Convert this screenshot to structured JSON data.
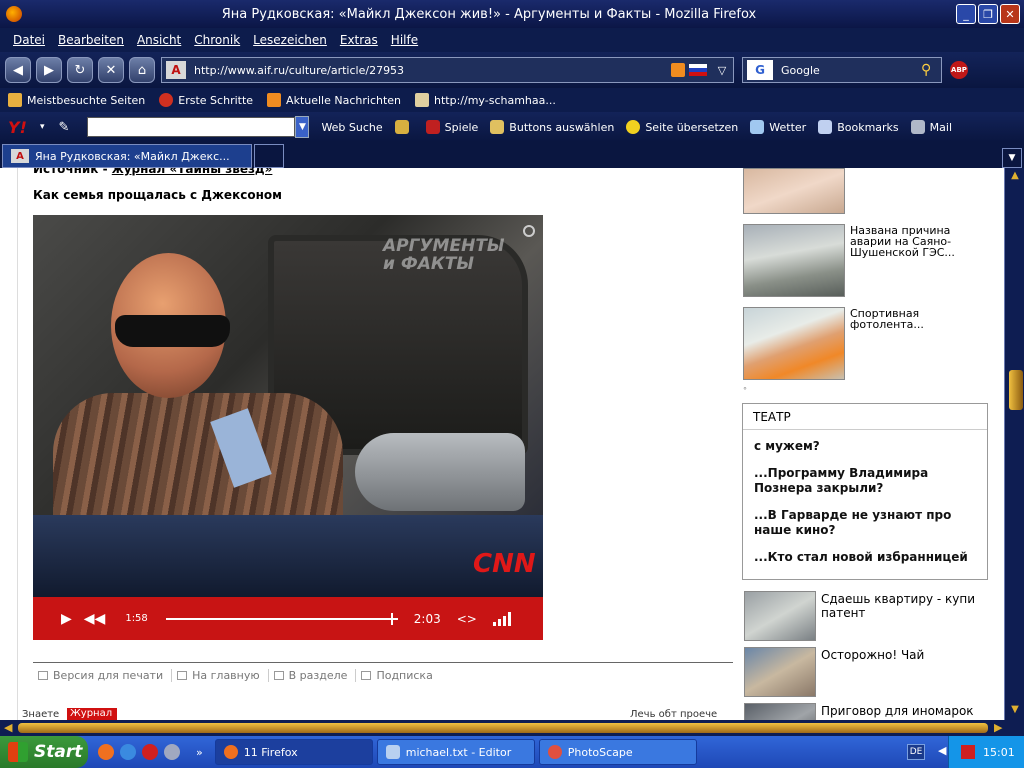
{
  "window": {
    "title": "Яна Рудковская: «Майкл Джексон жив!» - Аргументы и Факты - Mozilla Firefox",
    "min": "_",
    "max": "❐",
    "close": "✕"
  },
  "menu": [
    "Datei",
    "Bearbeiten",
    "Ansicht",
    "Chronik",
    "Lesezeichen",
    "Extras",
    "Hilfe"
  ],
  "nav": {
    "url": "http://www.aif.ru/culture/article/27953",
    "site_icon_text": "A",
    "search_engine": "Google",
    "abp": "ABP"
  },
  "bookmarks": [
    "Meistbesuchte Seiten",
    "Erste Schritte",
    "Aktuelle Nachrichten",
    "http://my-schamhaa..."
  ],
  "yahoo": {
    "logo": "Y!",
    "items": [
      "Web Suche",
      "Spiele",
      "Buttons auswählen",
      "Seite übersetzen",
      "Wetter",
      "Bookmarks",
      "Mail"
    ]
  },
  "tab": {
    "label": "Яна Рудковская: «Майкл Джекс...",
    "icon_text": "A"
  },
  "article": {
    "source_prefix": "Источник - ",
    "source_link": "журнал «Тайны звезд»",
    "subhead": "Как семья прощалась с Джексоном",
    "video": {
      "watermark_line1": "АРГУМЕНТЫ",
      "watermark_line2": "и ФАКТЫ",
      "logo": "CNN",
      "current_time": "1:58",
      "total_time": "2:03",
      "embed": "<>",
      "progress": 0.97
    },
    "actions": [
      "Версия для печати",
      "На главную",
      "В разделе",
      "Подписка"
    ],
    "bottom_left": "Знаете",
    "bottom_badge": "Журнал",
    "bottom_right": "Лечь обт проече"
  },
  "sidebar": {
    "thumbs": [
      {
        "text": ""
      },
      {
        "text": "Названа причина аварии на Саяно-Шушенской ГЭС..."
      },
      {
        "text": "Спортивная фотолента..."
      }
    ],
    "dot": "°",
    "teatr": {
      "header": "ТЕАТР",
      "items": [
        "с мужем?",
        "...Программу Владимира Познера закрыли?",
        "...В Гарварде не узнают про наше кино?",
        "...Кто стал новой избранницей"
      ]
    },
    "list": [
      "Сдаешь квартиру - купи патент",
      "Осторожно! Чай",
      "Приговор для иномарок"
    ]
  },
  "taskbar": {
    "start": "Start",
    "tasks": [
      {
        "label": "11 Firefox"
      },
      {
        "label": "michael.txt - Editor"
      },
      {
        "label": "PhotoScape"
      }
    ],
    "lang": "DE",
    "clock": "15:01"
  }
}
